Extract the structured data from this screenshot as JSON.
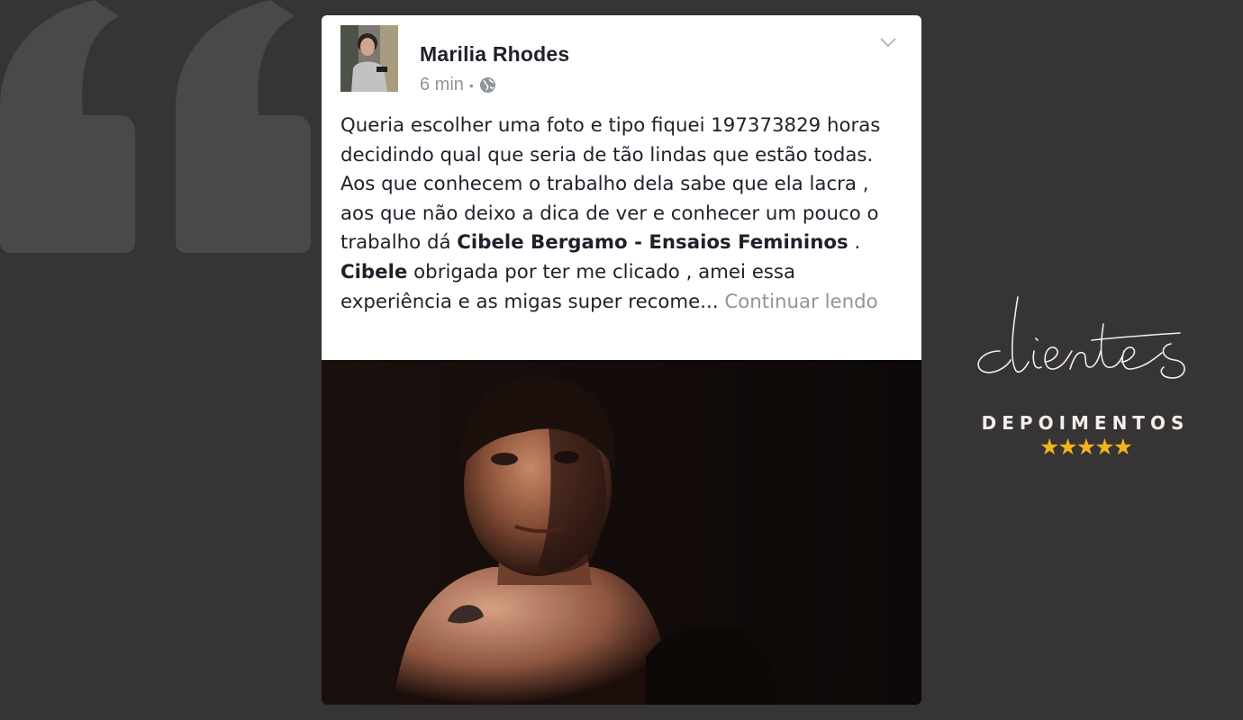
{
  "post": {
    "author": "Marilia Rhodes",
    "time": "6 min",
    "separator": "•",
    "text_1": "Queria escolher uma foto e tipo fiquei 197373829 horas decidindo qual que seria de tão lindas que estão todas. Aos que conhecem o trabalho dela sabe que ela lacra , aos que não deixo a dica de ver e conhecer um pouco o trabalho dá ",
    "mention_1": "Cibele Bergamo - Ensaios Femininos",
    "text_2": " . ",
    "mention_2": "Cibele",
    "text_3": " obrigada por ter me clicado , amei essa experiência e as migas super recome... ",
    "continue_label": "Continuar lendo"
  },
  "icons": {
    "globe": "globe-icon",
    "chevron": "chevron-down-icon",
    "quote": "quote-mark-icon"
  },
  "brand": {
    "script_word": "clientes",
    "title": "DEPOIMENTOS",
    "stars": "★★★★★",
    "stars_count": 5,
    "star_color": "#f3b31b"
  }
}
